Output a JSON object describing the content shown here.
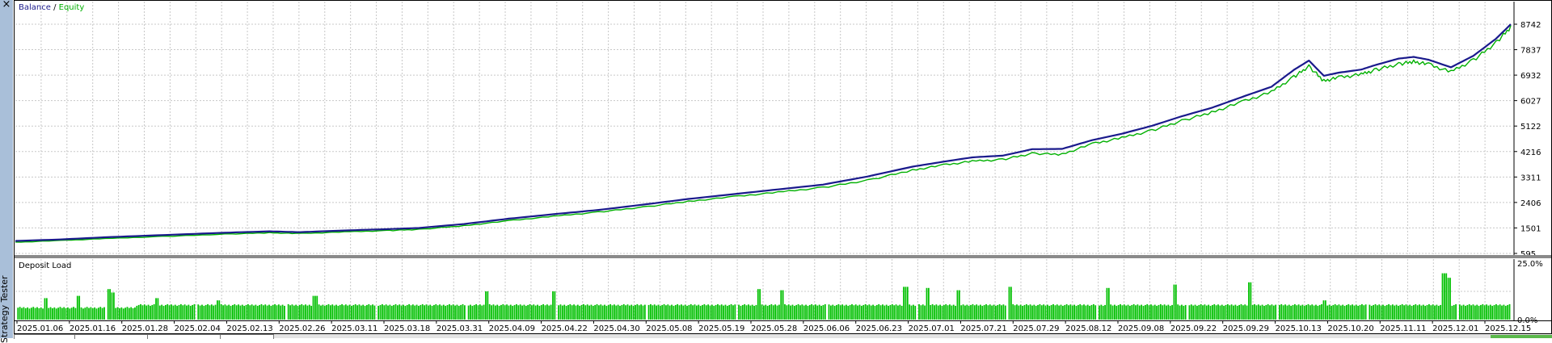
{
  "window": {
    "side_title": "Strategy Tester",
    "close_glyph": "×"
  },
  "chart_data": [
    {
      "type": "line",
      "title": "",
      "legend": [
        "Balance",
        "Equity"
      ],
      "legend_separator": " / ",
      "legend_placement": "top-left",
      "colors": {
        "Balance": "#1a1a8c",
        "Equity": "#00b000"
      },
      "grid": true,
      "ylim": [
        595,
        8742
      ],
      "y_ticks": [
        8742,
        7837,
        6932,
        6027,
        5122,
        4216,
        3311,
        2406,
        1501,
        595
      ],
      "x_tick_labels": [
        "2025.01.06",
        "2025.01.16",
        "2025.01.28",
        "2025.02.04",
        "2025.02.13",
        "2025.02.26",
        "2025.03.11",
        "2025.03.18",
        "2025.03.31",
        "2025.04.09",
        "2025.04.22",
        "2025.04.30",
        "2025.05.08",
        "2025.05.19",
        "2025.05.28",
        "2025.06.06",
        "2025.06.23",
        "2025.07.01",
        "2025.07.21",
        "2025.07.29",
        "2025.08.12",
        "2025.09.08",
        "2025.09.22",
        "2025.09.29",
        "2025.10.13",
        "2025.10.20",
        "2025.11.11",
        "2025.12.01",
        "2025.12.15"
      ],
      "series": [
        {
          "name": "Balance",
          "x": [
            0,
            0.03,
            0.06,
            0.1,
            0.14,
            0.17,
            0.19,
            0.22,
            0.25,
            0.27,
            0.3,
            0.33,
            0.36,
            0.39,
            0.42,
            0.45,
            0.48,
            0.51,
            0.54,
            0.57,
            0.6,
            0.62,
            0.64,
            0.66,
            0.68,
            0.7,
            0.72,
            0.74,
            0.76,
            0.78,
            0.8,
            0.82,
            0.84,
            0.855,
            0.865,
            0.875,
            0.885,
            0.9,
            0.91,
            0.925,
            0.935,
            0.945,
            0.96,
            0.975,
            0.99,
            1.0
          ],
          "values": [
            1040,
            1090,
            1170,
            1250,
            1330,
            1380,
            1350,
            1410,
            1460,
            1500,
            1640,
            1830,
            1990,
            2140,
            2330,
            2530,
            2700,
            2870,
            3040,
            3330,
            3680,
            3850,
            4010,
            4070,
            4300,
            4310,
            4620,
            4850,
            5130,
            5470,
            5770,
            6150,
            6520,
            7120,
            7450,
            6910,
            7020,
            7130,
            7300,
            7520,
            7580,
            7480,
            7210,
            7620,
            8220,
            8740
          ]
        },
        {
          "name": "Equity",
          "x": [
            0,
            0.03,
            0.06,
            0.1,
            0.14,
            0.17,
            0.19,
            0.22,
            0.25,
            0.27,
            0.3,
            0.33,
            0.36,
            0.39,
            0.42,
            0.45,
            0.48,
            0.51,
            0.54,
            0.57,
            0.6,
            0.62,
            0.64,
            0.66,
            0.68,
            0.7,
            0.72,
            0.74,
            0.76,
            0.78,
            0.8,
            0.82,
            0.84,
            0.855,
            0.865,
            0.875,
            0.885,
            0.9,
            0.91,
            0.925,
            0.935,
            0.945,
            0.96,
            0.975,
            0.99,
            1.0
          ],
          "values": [
            1000,
            1060,
            1130,
            1210,
            1290,
            1340,
            1310,
            1370,
            1420,
            1460,
            1590,
            1770,
            1930,
            2080,
            2260,
            2460,
            2630,
            2790,
            2960,
            3220,
            3580,
            3760,
            3900,
            3960,
            4180,
            4150,
            4520,
            4740,
            5000,
            5350,
            5650,
            6020,
            6380,
            6920,
            7300,
            6780,
            6900,
            7010,
            7180,
            7380,
            7470,
            7370,
            7100,
            7520,
            8140,
            8700
          ]
        }
      ]
    },
    {
      "type": "bar",
      "title": "Deposit Load",
      "color": "#00c000",
      "ylim": [
        0,
        25
      ],
      "y_ticks": [
        "25.0%",
        "0.0%"
      ],
      "bar_count": 780,
      "base_load_pct": 6.5,
      "peaks_pct": [
        {
          "x": 0.02,
          "v": 9.5
        },
        {
          "x": 0.042,
          "v": 10.5
        },
        {
          "x": 0.063,
          "v": 13.5
        },
        {
          "x": 0.065,
          "v": 12
        },
        {
          "x": 0.094,
          "v": 9.5
        },
        {
          "x": 0.135,
          "v": 8.5
        },
        {
          "x": 0.2,
          "v": 10.5
        },
        {
          "x": 0.315,
          "v": 12.5
        },
        {
          "x": 0.36,
          "v": 12.5
        },
        {
          "x": 0.497,
          "v": 13.5
        },
        {
          "x": 0.512,
          "v": 13
        },
        {
          "x": 0.595,
          "v": 14.5
        },
        {
          "x": 0.61,
          "v": 14
        },
        {
          "x": 0.63,
          "v": 13
        },
        {
          "x": 0.665,
          "v": 14.5
        },
        {
          "x": 0.73,
          "v": 14
        },
        {
          "x": 0.775,
          "v": 15.5
        },
        {
          "x": 0.825,
          "v": 16.5
        },
        {
          "x": 0.875,
          "v": 8.5
        },
        {
          "x": 0.955,
          "v": 20.5
        },
        {
          "x": 0.958,
          "v": 18.5
        }
      ]
    }
  ]
}
